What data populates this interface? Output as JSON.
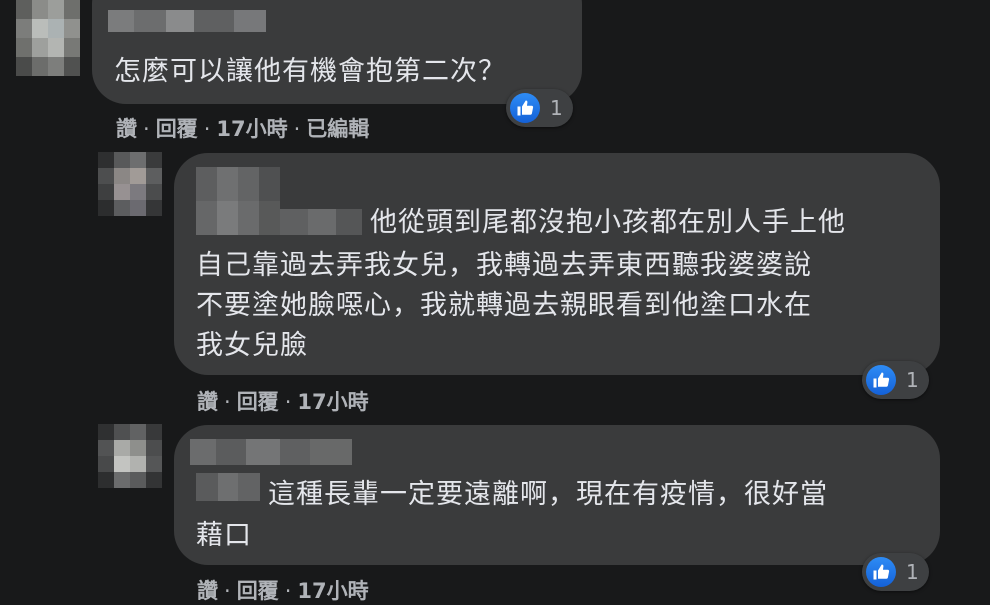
{
  "comments": [
    {
      "text": "怎麼可以讓他有機會抱第二次？",
      "actions": {
        "like": "讚",
        "reply": "回覆",
        "time": "17小時",
        "edited": "已編輯"
      },
      "reactions": {
        "icon": "thumbs-up-icon",
        "count": "1"
      }
    },
    {
      "text_lines": [
        "他從頭到尾都沒抱小孩都在別人手上他",
        "自己靠過去弄我女兒，我轉過去弄東西聽我婆婆說",
        "不要塗她臉噁心，我就轉過去親眼看到他塗口水在",
        "我女兒臉"
      ],
      "actions": {
        "like": "讚",
        "reply": "回覆",
        "time": "17小時"
      },
      "reactions": {
        "icon": "thumbs-up-icon",
        "count": "1"
      }
    },
    {
      "text_lines": [
        "這種長輩一定要遠離啊，現在有疫情，很好當",
        "藉口"
      ],
      "actions": {
        "like": "讚",
        "reply": "回覆",
        "time": "17小時"
      },
      "reactions": {
        "icon": "thumbs-up-icon",
        "count": "1"
      }
    }
  ],
  "colors": {
    "background": "#18191a",
    "bubble": "#3a3b3c",
    "text": "#e4e6eb",
    "secondary_text": "#b0b3b8",
    "like_blue": "#1877f2"
  }
}
